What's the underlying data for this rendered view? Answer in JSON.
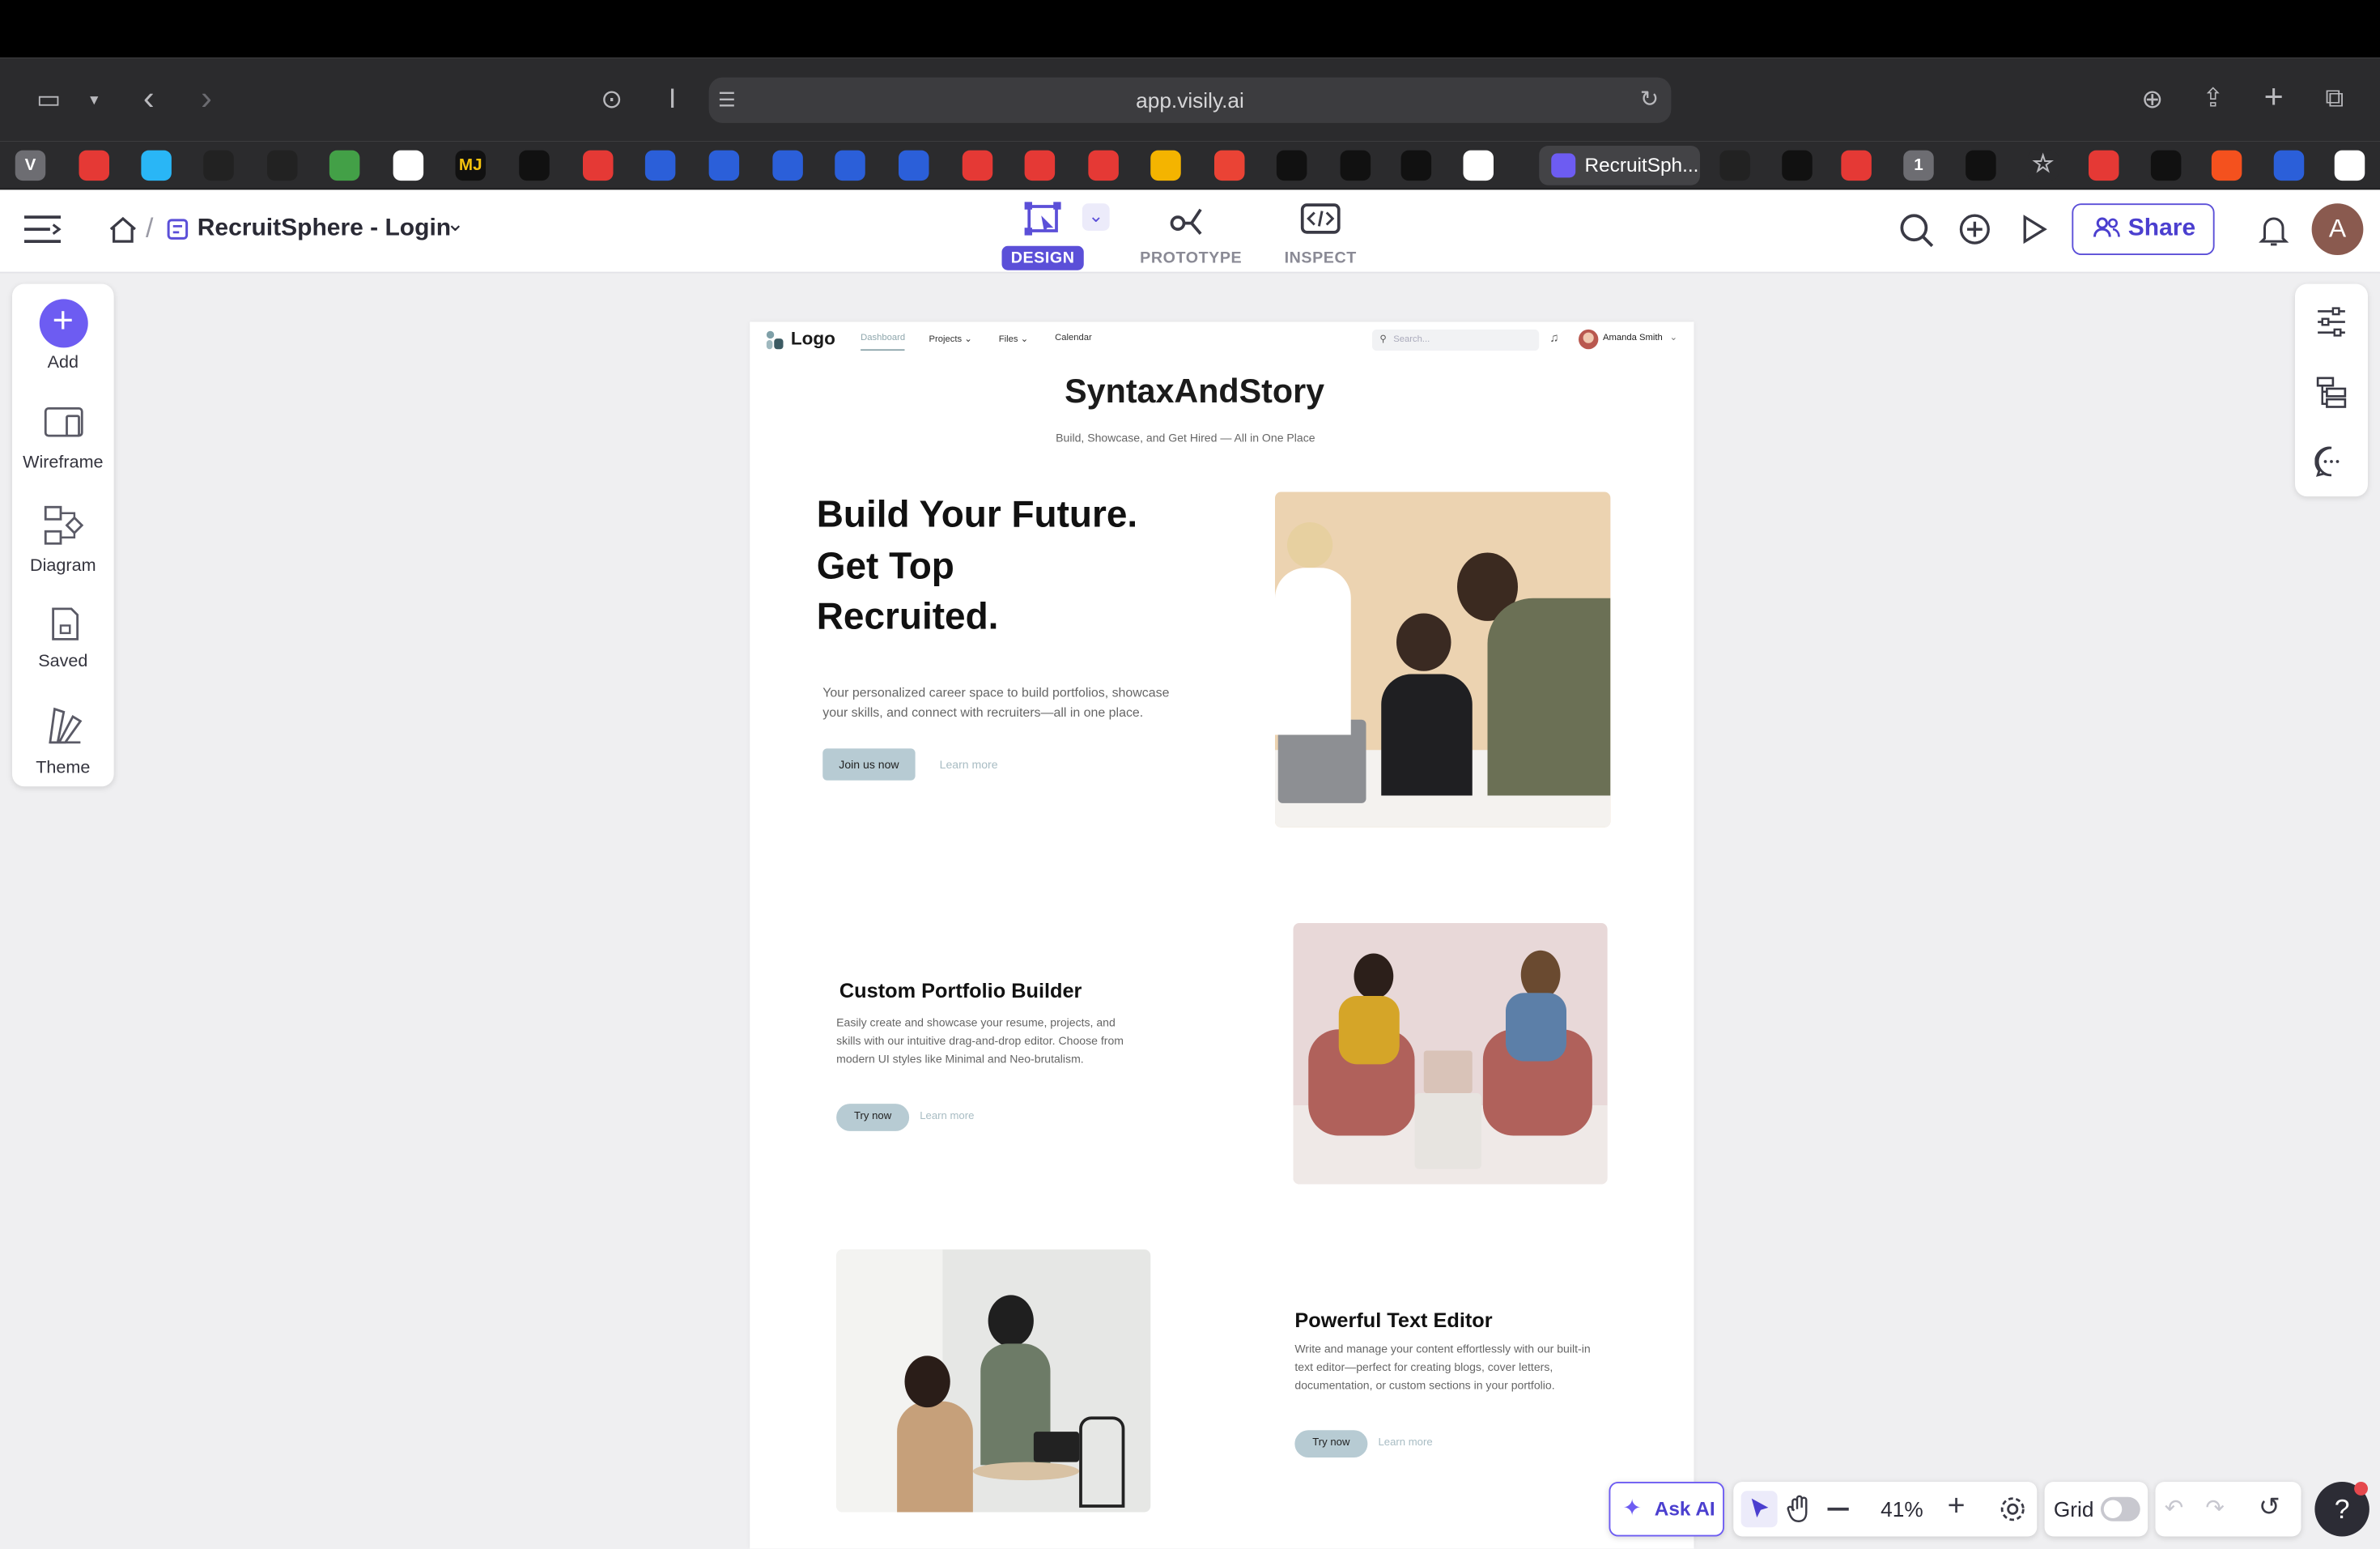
{
  "browser": {
    "url": "app.visily.ai",
    "active_tab_title": "RecruitSph...",
    "bookmark_labels": [
      "V",
      "MJ",
      "1"
    ]
  },
  "app": {
    "breadcrumb_title": "RecruitSphere - Login",
    "modes": [
      {
        "label": "DESIGN",
        "active": true
      },
      {
        "label": "PROTOTYPE",
        "active": false
      },
      {
        "label": "INSPECT",
        "active": false
      }
    ],
    "share_label": "Share",
    "avatar_initial": "A"
  },
  "left_tools": [
    {
      "label": "Add",
      "icon": "plus-icon"
    },
    {
      "label": "Wireframe",
      "icon": "wireframe-icon"
    },
    {
      "label": "Diagram",
      "icon": "diagram-icon"
    },
    {
      "label": "Saved",
      "icon": "saved-icon"
    },
    {
      "label": "Theme",
      "icon": "theme-icon"
    }
  ],
  "design": {
    "nav": {
      "logo": "Logo",
      "links": [
        "Dashboard",
        "Projects",
        "Files",
        "Calendar"
      ],
      "search_placeholder": "Search...",
      "user_name": "Amanda Smith"
    },
    "brand_title": "SyntaxAndStory",
    "brand_subtitle": "Build, Showcase, and Get Hired — All in One Place",
    "hero": {
      "heading_lines": [
        "Build Your Future.",
        "Get Top",
        "Recruited."
      ],
      "description": "Your personalized career space to build portfolios, showcase your skills, and connect with recruiters—all in one place.",
      "primary_button": "Join us now",
      "secondary_link": "Learn more"
    },
    "features": [
      {
        "title": "Custom Portfolio Builder",
        "description": "Easily create and showcase your resume, projects, and skills with our intuitive drag-and-drop editor. Choose from modern UI styles like Minimal and Neo-brutalism.",
        "primary_button": "Try now",
        "secondary_link": "Learn more"
      },
      {
        "title": "Powerful Text Editor",
        "description": "Write and manage your content effortlessly with our built-in text editor—perfect for creating blogs, cover letters, documentation, or custom sections in your portfolio.",
        "primary_button": "Try now",
        "secondary_link": "Learn more"
      }
    ]
  },
  "bottom_bar": {
    "ask_ai": "Ask AI",
    "zoom": "41%",
    "grid_label": "Grid",
    "grid_on": false
  },
  "colors": {
    "accent": "#5b4fd8",
    "button_muted": "#b7cbd3"
  }
}
